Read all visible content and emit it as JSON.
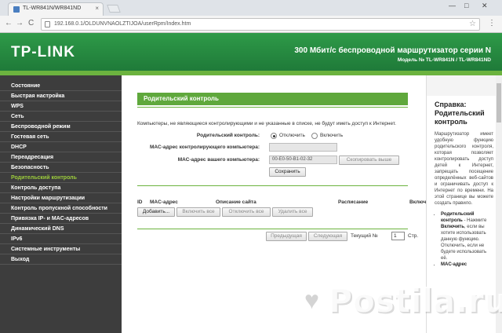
{
  "browser": {
    "tab_title": "TL-WR841N/WR841ND",
    "close": "×",
    "url": "192.168.0.1/OLDUNVNAOLZTIJOA/userRpm/Index.htm",
    "back": "←",
    "forward": "→",
    "reload": "C",
    "star": "☆",
    "menu": "⋮",
    "win_min": "—",
    "win_max": "□",
    "win_close": "✕"
  },
  "banner": {
    "logo": "TP-LINK",
    "title": "300 Мбит/с беспроводной маршрутизатор серии N",
    "model": "Модель № TL-WR841N / TL-WR841ND"
  },
  "sidebar": {
    "items": [
      {
        "label": "Состояние"
      },
      {
        "label": "Быстрая настройка"
      },
      {
        "label": "WPS"
      },
      {
        "label": "Сеть"
      },
      {
        "label": "Беспроводной режим"
      },
      {
        "label": "Гостевая сеть"
      },
      {
        "label": "DHCP"
      },
      {
        "label": "Переадресация"
      },
      {
        "label": "Безопасность"
      },
      {
        "label": "Родительский контроль"
      },
      {
        "label": "Контроль доступа"
      },
      {
        "label": "Настройки маршрутизации"
      },
      {
        "label": "Контроль пропускной способности"
      },
      {
        "label": "Привязка IP- и MAC-адресов"
      },
      {
        "label": "Динамический DNS"
      },
      {
        "label": "IPv6"
      },
      {
        "label": "Системные инструменты"
      },
      {
        "label": "Выход"
      }
    ]
  },
  "main": {
    "title": "Родительский контроль",
    "description": "Компьютеры, не являющиеся контролирующими и не указанные в списке, не будут иметь доступ к Интернет.",
    "pc_label": "Родительский контроль:",
    "off_label": "Отключить",
    "on_label": "Включить",
    "mac_ctrl_label": "MAC-адрес контролирующего компьютера:",
    "mac_ctrl_value": "",
    "mac_self_label": "MAC-адрес вашего компьютера:",
    "mac_self_value": "00-E0-50-B1-02-32",
    "copy_button": "Скопировать выше",
    "save_button": "Сохранить",
    "table": {
      "headers": [
        "ID",
        "MAC-адрес",
        "Описание сайта",
        "Расписание",
        "Включ"
      ]
    },
    "add_button": "Добавить...",
    "enable_all": "Включить все",
    "disable_all": "Отключить все",
    "delete_all": "Удалить все",
    "prev_button": "Предыдущая",
    "next_button": "Следующая",
    "current_label": "Текущий №",
    "current_value": "1",
    "page_suffix": "Стр."
  },
  "help": {
    "title": "Справка: Родительский контроль",
    "text": "Маршрутизатор имеет удобную функцию родительского контроля, которая позволяет контролировать доступ детей к Интернет, запрещать посещение определённых веб-сайтов и ограничивать доступ к Интернет по времени. На этой странице вы можете создать правило.",
    "item1_bold": "Родительский контроль",
    "item1_text": " - Нажмите ",
    "item1_bold2": "Включить",
    "item1_text2": ", если вы хотите использовать данную функцию. Отключить, если не будете использовать её.",
    "item2_bold": "MAC-адрес"
  },
  "watermark": {
    "text": "Postila.ru"
  }
}
